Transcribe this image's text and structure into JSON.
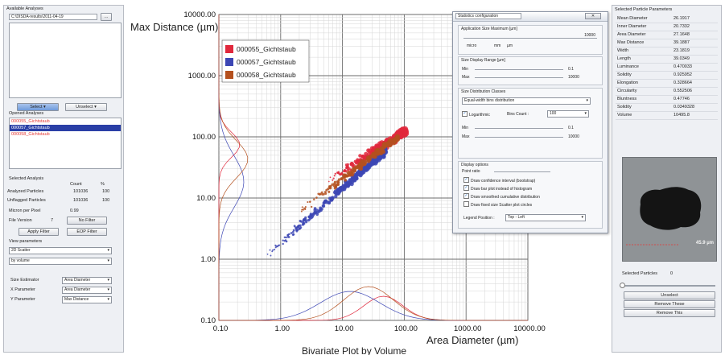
{
  "left_panel": {
    "group_title": "Available Analyses",
    "path": "C:\\DISDA-results\\2011-04-19",
    "browse_label": "...",
    "select_label": "Select",
    "unselect_label": "Unselect",
    "opened_label": "Opened Analyses",
    "analyses": [
      {
        "name": "000055_Gichtstaub",
        "color": "#e53935",
        "selected": false
      },
      {
        "name": "000057_Gichtstaub",
        "color": "#ffffff",
        "selected": true
      },
      {
        "name": "000058_Gichtstaub",
        "color": "#e53935",
        "selected": false
      }
    ],
    "selected_analysis_label": "Selected Analysis",
    "count_header": "Count",
    "pct_header": "%",
    "stats": [
      {
        "label": "Analyzed Particles",
        "count": "101036",
        "pct": "100"
      },
      {
        "label": "Unflagged Particles",
        "count": "101036",
        "pct": "100"
      }
    ],
    "micron_label": "Micron per Pixel",
    "micron_value": "0.99",
    "file_version_label": "File Version",
    "file_version_value": "7",
    "no_filter_label": "No Filter",
    "apply_filter_label": "Apply Filter",
    "eop_filter_label": "EOP Filter",
    "view_params_label": "View parameters",
    "view_mode": "2D Scatter",
    "weighting": "by volume",
    "param_rows": [
      {
        "label": "Size Estimator",
        "value": "Area Diameter"
      },
      {
        "label": "X Parameter",
        "value": "Area Diameter"
      },
      {
        "label": "Y Parameter",
        "value": "Max Distance"
      }
    ]
  },
  "chart_data": {
    "type": "scatter",
    "title": "Bivariate Plot by Volume",
    "xlabel": "Area Diameter (µm)",
    "ylabel": "Max Distance (µm)",
    "x_scale": "log",
    "y_scale": "log",
    "xlim": [
      0.1,
      10000
    ],
    "ylim": [
      0.1,
      10000
    ],
    "x_ticks": [
      "0.10",
      "1.00",
      "10.00",
      "100.00",
      "1000.00",
      "10000.00"
    ],
    "y_ticks": [
      "0.10",
      "1.00",
      "10.00",
      "100.00",
      "1000.00",
      "10000.00"
    ],
    "grid": true,
    "legend_position": "top-left",
    "series": [
      {
        "name": "000055_Gichtstaub",
        "color": "#e0283c",
        "x_range": [
          6,
          110
        ],
        "y_range": [
          20,
          130
        ]
      },
      {
        "name": "000057_Gichtstaub",
        "color": "#3c46b4",
        "x_range": [
          0.6,
          50
        ],
        "y_range": [
          1.2,
          60
        ]
      },
      {
        "name": "000058_Gichtstaub",
        "color": "#b4501e",
        "x_range": [
          2,
          80
        ],
        "y_range": [
          6,
          100
        ]
      }
    ]
  },
  "dialog": {
    "title": "Statistics configuration",
    "close_icon": "close-icon",
    "app_size_group": "Application Size Maximum [µm]",
    "app_size_value": "10000",
    "app_size_ticks": [
      "micro",
      "mm",
      "µm"
    ],
    "size_range_group": "Size Display Range [µm]",
    "min_label": "Min",
    "max_label": "Max",
    "range_min": "0.1",
    "range_max": "10000",
    "classes_group": "Size Distribution Classes",
    "distribution": "Equal-width bins distribution",
    "log_label": "Logarithmic",
    "log_checked": true,
    "bins_label": "Bins Count :",
    "bins_value": "100",
    "classes_min": "0.1",
    "classes_max": "10000",
    "display_group": "Display options",
    "point_ratio_label": "Point ratio",
    "options": [
      {
        "label": "Draw confidence interval (bootstrap)",
        "checked": true
      },
      {
        "label": "Draw bar plot instead of histogram",
        "checked": true
      },
      {
        "label": "Draw smoothed cumulative distribution",
        "checked": true
      },
      {
        "label": "Draw fixed size Scatter plot circles",
        "checked": false
      }
    ],
    "legend_position_label": "Legend Position :",
    "legend_position_value": "Top - Left"
  },
  "right_panel": {
    "title": "Selected Particle Parameters",
    "params": [
      {
        "label": "Mean Diameter",
        "value": "26.1917"
      },
      {
        "label": "Inner Diameter",
        "value": "20.7332"
      },
      {
        "label": "Area Diameter",
        "value": "27.1648"
      },
      {
        "label": "Max Distance",
        "value": "39.1887"
      },
      {
        "label": "Width",
        "value": "23.1819"
      },
      {
        "label": "Length",
        "value": "39.0349"
      },
      {
        "label": "Luminance",
        "value": "0.470033"
      },
      {
        "label": "Solidity",
        "value": "0.925952"
      },
      {
        "label": "Elongation",
        "value": "0.328664"
      },
      {
        "label": "Circularity",
        "value": "0.552506"
      },
      {
        "label": "Bluntness",
        "value": "0.47746"
      },
      {
        "label": "Solidity",
        "value": "0.0349328"
      },
      {
        "label": "Volume",
        "value": "10495.8"
      }
    ],
    "scale_text": "45.9 µm",
    "selected_particles_label": "Selected Particles",
    "selected_particles_value": "0",
    "unselect_label": "Unselect",
    "remove_these_label": "Remove These",
    "remove_this_label": "Remove This"
  }
}
